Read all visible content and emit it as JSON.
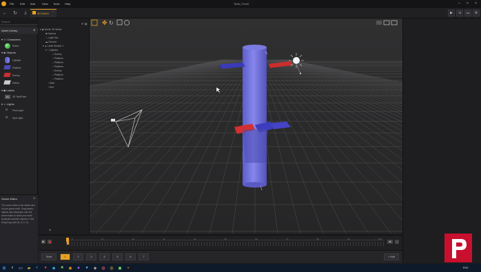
{
  "app": {
    "title": "Tools_Fred4"
  },
  "menu": [
    "File",
    "Edit",
    "Add",
    "View",
    "Tools",
    "Help"
  ],
  "tab": {
    "label": "3D World"
  },
  "search": {
    "placeholder": "Search"
  },
  "library": {
    "title": "Asset Library",
    "sections": {
      "characters": "Characters",
      "objects": "Objects",
      "labels": "Labels",
      "lights": "Lights"
    },
    "characters": [
      "Robot"
    ],
    "objects": [
      "Cylinder",
      "Platform",
      "Enemy",
      "Debris"
    ],
    "labels": [
      "3D Text/Point"
    ],
    "lights": [
      "Point Light",
      "Spot Light"
    ]
  },
  "hierarchy": {
    "root": "World: 3D World",
    "items": [
      "Camera",
      "Light Sun",
      "Ground",
      "Level Section 1",
      "Cylinder",
      "Enemy",
      "Platform",
      "Platform",
      "Platform",
      "Enemy",
      "Platform",
      "Platform",
      "Start",
      "End"
    ]
  },
  "scene_editor": {
    "title": "Scene Editor",
    "text": "The scene editor is the inside view of your game world. Drag assets, objects and characters onto the scene editor to build your levels. Duplicate selected objects in Tool Drag/Copy with (R, A, D, S)."
  },
  "timeline": {
    "ticks": [
      "0",
      "10",
      "20",
      "30",
      "40",
      "50",
      "60",
      "70",
      "80",
      "90",
      "100"
    ]
  },
  "levels": {
    "start": "Start",
    "items": [
      "1",
      "2",
      "3",
      "4",
      "5",
      "6",
      "7"
    ],
    "add": "+ Add"
  },
  "taskbar": {
    "time": "ENG"
  }
}
